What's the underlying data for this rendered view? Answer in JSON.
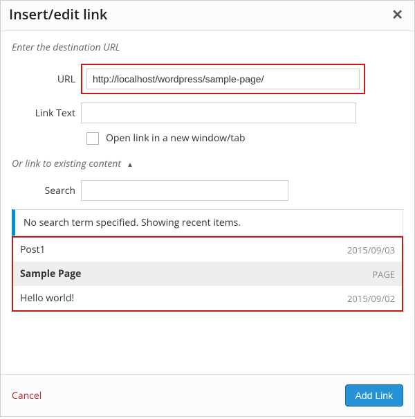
{
  "dialog": {
    "title": "Insert/edit link",
    "sections": {
      "enter_url_label": "Enter the destination URL",
      "or_link_label": "Or link to existing content"
    },
    "fields": {
      "url_label": "URL",
      "url_value": "http://localhost/wordpress/sample-page/",
      "link_text_label": "Link Text",
      "link_text_value": "",
      "new_tab_label": "Open link in a new window/tab",
      "search_label": "Search",
      "search_value": ""
    },
    "notice": "No search term specified. Showing recent items.",
    "results": [
      {
        "title": "Post1",
        "meta": "2015/09/03",
        "selected": false
      },
      {
        "title": "Sample Page",
        "meta": "PAGE",
        "selected": true
      },
      {
        "title": "Hello world!",
        "meta": "2015/09/02",
        "selected": false
      }
    ],
    "footer": {
      "cancel": "Cancel",
      "add_link": "Add Link"
    }
  }
}
